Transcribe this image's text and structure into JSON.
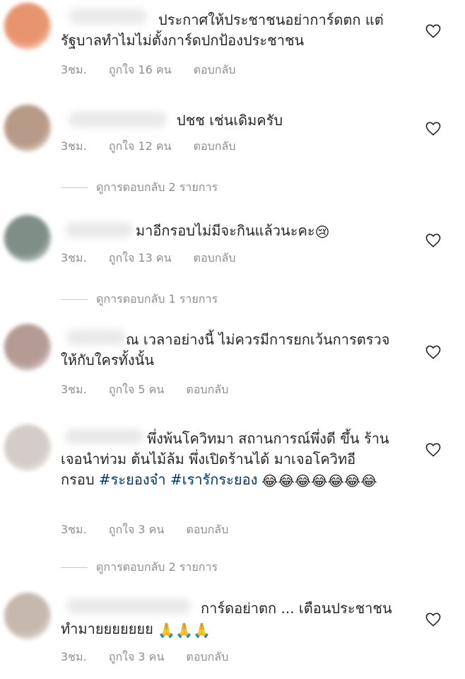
{
  "comments": [
    {
      "lines": [
        "ประกาศให้ประชาชนอย่าการ์ดตก แต่",
        "รัฐบาลทำไมไม่ตั้งการ์ดปกป้องประชาชน"
      ],
      "time": "3ชม.",
      "likes": "ถูกใจ 16 คน",
      "reply": "ตอบกลับ",
      "avatar_color": "#e8956f"
    },
    {
      "lines": [
        "ปชช เช่นเดิมครับ"
      ],
      "time": "3ชม.",
      "likes": "ถูกใจ 12 คน",
      "reply": "ตอบกลับ",
      "view_replies": "ดูการตอบกลับ 2 รายการ",
      "avatar_color": "#b79a88"
    },
    {
      "lines": [
        "มาอีกรอบไม่มีจะกินแล้วนะคะ"
      ],
      "emoji_end": "😢",
      "time": "3ชม.",
      "likes": "ถูกใจ 13 คน",
      "reply": "ตอบกลับ",
      "view_replies": "ดูการตอบกลับ 1 รายการ",
      "avatar_color": "#7f8f87"
    },
    {
      "lines": [
        "ณ เวลาอย่างนี้ ไม่ควรมีการยกเว้นการตรวจ",
        "ให้กับใครทั้งนั้น"
      ],
      "time": "3ชม.",
      "likes": "ถูกใจ 5 คน",
      "reply": "ตอบกลับ",
      "avatar_color": "#b49c94"
    },
    {
      "lines": [
        "พึ่งพ้นโควิทมา สถานการณ์พึ่งดี ขึ้น ร้าน",
        "เจอนำท่วม ต้นไม้ล้ม พึ่งเปิดร้านได้  มาเจอโควิทอี",
        "กรอบ"
      ],
      "hashtags": [
        "#ระยองจ๋า",
        "#เรารักระยอง"
      ],
      "emojis": "😂😂😂😂😂😂😂",
      "time": "3ชม.",
      "likes": "ถูกใจ 3 คน",
      "reply": "ตอบกลับ",
      "view_replies": "ดูการตอบกลับ 2 รายการ",
      "avatar_color": "#d4ccc6"
    },
    {
      "lines": [
        "การ์ดอย่าตก ... เตือนประชาชน",
        "ทำมายยยยยยย"
      ],
      "emoji_end": "🙏🙏🙏",
      "time": "3ชม.",
      "likes": "ถูกใจ 3 คน",
      "reply": "ตอบกลับ",
      "avatar_color": "#c6b8ad"
    }
  ]
}
